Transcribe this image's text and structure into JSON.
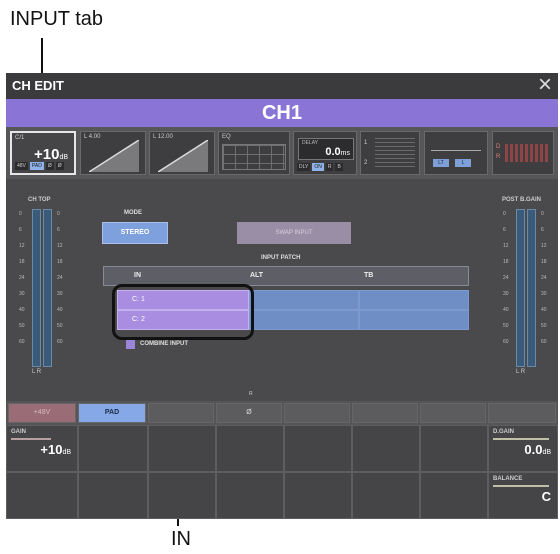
{
  "callouts": {
    "input_tab": "INPUT tab",
    "in": "IN"
  },
  "window": {
    "title": "CH EDIT",
    "close_glyph": "×",
    "channel_name": "CH1"
  },
  "strip": {
    "input_tab": {
      "label": "C/1",
      "value": "+10",
      "unit": "dB",
      "chips": [
        "48V",
        "PAD",
        "Ø",
        "Ø"
      ]
    },
    "hpf_tab": {
      "label": "L 4.00"
    },
    "gate_tab": {
      "label": "L 12.00"
    },
    "eq_tab": {
      "label": "EQ"
    },
    "delay_tab": {
      "label": "DELAY",
      "value": "0.0",
      "unit": "ms",
      "chips": [
        "DLY",
        "ON",
        "R",
        "B"
      ]
    },
    "dyn_tab": {
      "label": "1",
      "label2": "2"
    },
    "pan_tab": {
      "left": "LT",
      "right": "L"
    },
    "out_tab": {
      "label": "D",
      "label2": "R"
    }
  },
  "meters": {
    "left_label": "CH TOP",
    "right_label": "POST B.GAIN",
    "scale": [
      "0",
      "6",
      "12",
      "18",
      "24",
      "30",
      "40",
      "50",
      "60"
    ],
    "lr": "L  R"
  },
  "mode": {
    "label": "MODE",
    "stereo_button": "STEREO",
    "swap_button": "SWAP INPUT"
  },
  "patch": {
    "title": "INPUT PATCH",
    "headers": [
      "IN",
      "ALT",
      "TB"
    ],
    "rows": [
      {
        "in": "C: 1"
      },
      {
        "in": "C: 2"
      }
    ]
  },
  "combine": {
    "label": "COMBINE INPUT"
  },
  "bottom": {
    "small_label": "R",
    "buttons": [
      "+48V",
      "PAD",
      "",
      "Ø",
      "",
      "",
      "",
      ""
    ],
    "gain": {
      "label": "GAIN",
      "value": "+10",
      "unit": "dB"
    },
    "dgain": {
      "label": "D.GAIN",
      "value": "0.0",
      "unit": "dB"
    },
    "balance": {
      "label": "BALANCE",
      "value": "C"
    }
  },
  "colors": {
    "accent": "#8a75d6",
    "active_blue": "#7ea0dc",
    "patch_in": "#a88de0",
    "patch_cell": "#6f8ec6"
  }
}
